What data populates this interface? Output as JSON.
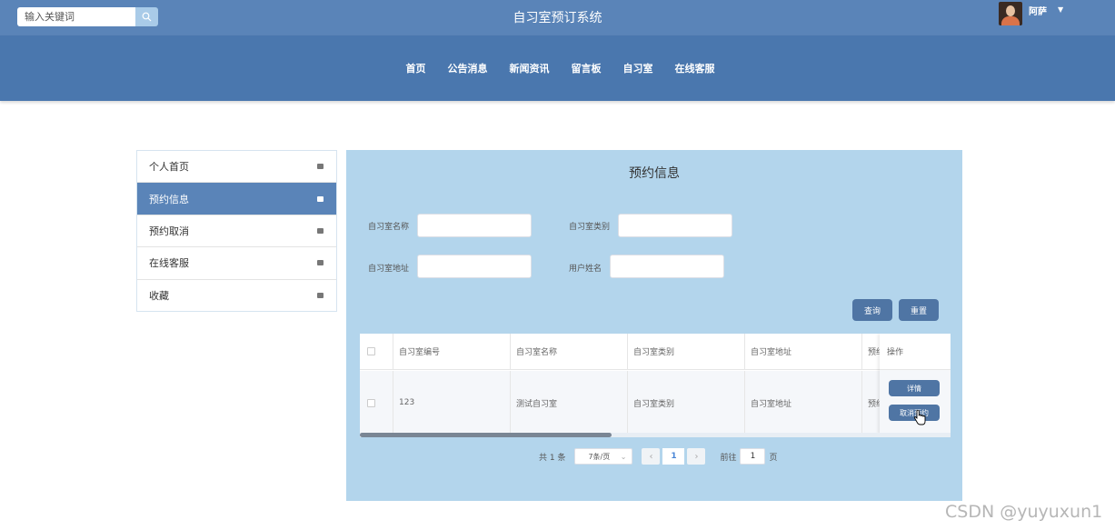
{
  "header": {
    "search_placeholder": "输入关键词",
    "site_title": "自习室预订系统",
    "username": "阿萨"
  },
  "nav": {
    "items": [
      "首页",
      "公告消息",
      "新闻资讯",
      "留言板",
      "自习室",
      "在线客服"
    ]
  },
  "sidebar": {
    "items": [
      {
        "label": "个人首页",
        "active": false
      },
      {
        "label": "预约信息",
        "active": true
      },
      {
        "label": "预约取消",
        "active": false
      },
      {
        "label": "在线客服",
        "active": false
      },
      {
        "label": "收藏",
        "active": false
      }
    ]
  },
  "main": {
    "title": "预约信息",
    "form": {
      "room_name_label": "自习室名称",
      "room_type_label": "自习室类别",
      "room_addr_label": "自习室地址",
      "username_label": "用户姓名"
    },
    "buttons": {
      "search": "查询",
      "reset": "重置"
    },
    "table": {
      "headers": [
        "自习室编号",
        "自习室名称",
        "自习室类别",
        "自习室地址",
        "预约",
        "操作"
      ],
      "rows": [
        {
          "id": "123",
          "name": "测试自习室",
          "type": "自习室类别",
          "addr": "自习室地址",
          "partial": "预约"
        }
      ],
      "actions": {
        "detail": "详情",
        "cancel": "取消预约"
      }
    },
    "pager": {
      "total": "共 1 条",
      "page_size": "7条/页",
      "current_page": "1",
      "goto_label": "前往",
      "goto_value": "1",
      "page_unit": "页",
      "prev": "‹",
      "next": "›"
    }
  },
  "watermark": "CSDN @yuyuxun1",
  "colors": {
    "header": "#5a84b8",
    "nav": "#4a77ae",
    "panel": "#b3d5ec",
    "button": "#4f75a4"
  }
}
